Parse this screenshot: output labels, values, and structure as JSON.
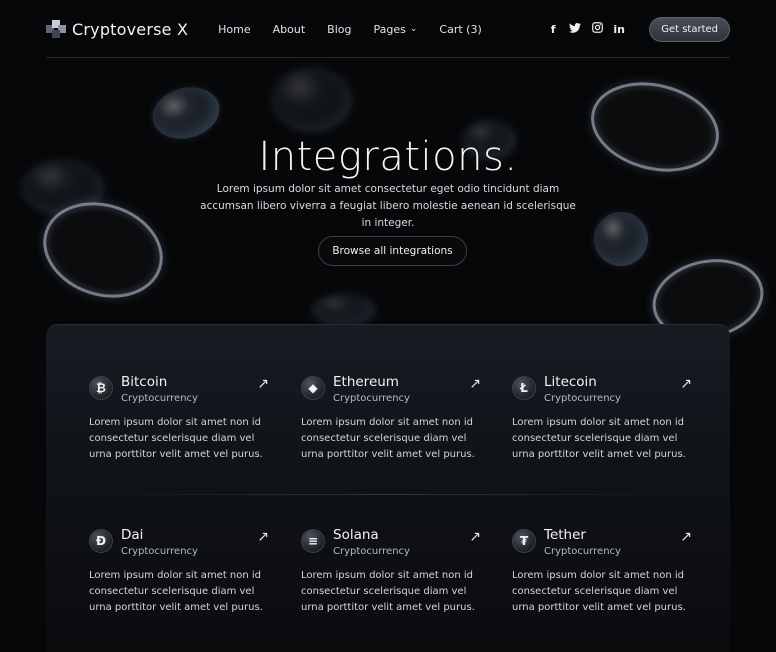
{
  "nav": {
    "brand": "Cryptoverse X",
    "links": [
      {
        "label": "Home"
      },
      {
        "label": "About"
      },
      {
        "label": "Blog"
      },
      {
        "label": "Pages",
        "dropdown": true
      },
      {
        "label": "Cart (3)"
      }
    ],
    "social": [
      {
        "icon": "facebook-icon",
        "glyph": "f"
      },
      {
        "icon": "twitter-icon",
        "glyph": "🐦"
      },
      {
        "icon": "instagram-icon",
        "glyph": "◙"
      },
      {
        "icon": "linkedin-icon",
        "glyph": "in"
      }
    ],
    "cta_label": "Get started"
  },
  "hero": {
    "title": "Integrations.",
    "text": "Lorem ipsum dolor sit amet consectetur eget odio tincidunt diam accumsan libero viverra a feugiat libero molestie aenean id scelerisque in integer.",
    "button_label": "Browse all integrations"
  },
  "integrations": [
    {
      "name": "Bitcoin",
      "category": "Cryptocurrency",
      "glyph": "₿",
      "icon": "bitcoin-icon",
      "description": "Lorem ipsum dolor sit amet non id consectetur scelerisque diam vel urna porttitor velit amet vel purus."
    },
    {
      "name": "Ethereum",
      "category": "Cryptocurrency",
      "glyph": "◆",
      "icon": "ethereum-icon",
      "description": "Lorem ipsum dolor sit amet non id consectetur scelerisque diam vel urna porttitor velit amet vel purus."
    },
    {
      "name": "Litecoin",
      "category": "Cryptocurrency",
      "glyph": "Ł",
      "icon": "litecoin-icon",
      "description": "Lorem ipsum dolor sit amet non id consectetur scelerisque diam vel urna porttitor velit amet vel purus."
    },
    {
      "name": "Dai",
      "category": "Cryptocurrency",
      "glyph": "Đ",
      "icon": "dai-icon",
      "description": "Lorem ipsum dolor sit amet non id consectetur scelerisque diam vel urna porttitor velit amet vel purus."
    },
    {
      "name": "Solana",
      "category": "Cryptocurrency",
      "glyph": "≡",
      "icon": "solana-icon",
      "description": "Lorem ipsum dolor sit amet non id consectetur scelerisque diam vel urna porttitor velit amet vel purus."
    },
    {
      "name": "Tether",
      "category": "Cryptocurrency",
      "glyph": "₮",
      "icon": "tether-icon",
      "description": "Lorem ipsum dolor sit amet non id consectetur scelerisque diam vel urna porttitor velit amet vel purus."
    }
  ],
  "arrow_glyph": "↗",
  "chevron_glyph": "⌄",
  "colors": {
    "background": "#060708",
    "panel": "#14181e",
    "accent": "#8fb6ff"
  }
}
